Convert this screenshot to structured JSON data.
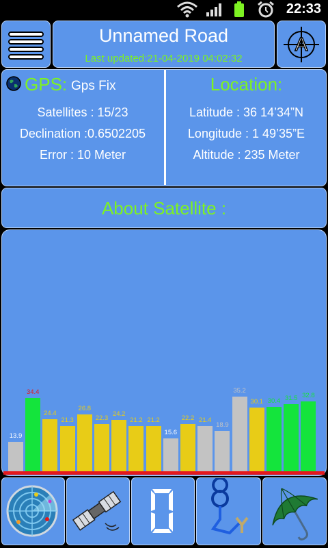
{
  "status_bar": {
    "time": "22:33"
  },
  "header": {
    "title": "Unnamed Road",
    "last_updated": "Last updated:21-04-2019 04:02:32"
  },
  "gps": {
    "title": "GPS:",
    "status": "Gps Fix",
    "satellites": "Satellites : 15/23",
    "declination": "Declination :0.6502205",
    "error": "Error : 10 Meter"
  },
  "location": {
    "title": "Location:",
    "latitude": "Latitude : 36  14’34”N",
    "longitude": "Longitude : 1  49’35”E",
    "altitude": "Altitude : 235 Meter"
  },
  "about": {
    "title": "About Satellite :"
  },
  "chart_data": {
    "type": "bar",
    "values": [
      13.9,
      34.4,
      24.4,
      21.3,
      26.8,
      22.3,
      24.2,
      21.2,
      21.2,
      15.6,
      22.2,
      21.4,
      18.9,
      35.2,
      30.1,
      30.4,
      31.5,
      32.8
    ],
    "labels": [
      "13.9",
      "34.4",
      "24.4",
      "21.3",
      "26.8",
      "22.3",
      "24.2",
      "21.2",
      "21.2",
      "15.6",
      "22.2",
      "21.4",
      "18.9",
      "35.2",
      "30.1",
      "30.4",
      "31.5",
      "32.8"
    ],
    "bar_colors": [
      "#c3c3c3",
      "#14e43c",
      "#e8cc17",
      "#e8cc17",
      "#e8cc17",
      "#e8cc17",
      "#e8cc17",
      "#e8cc17",
      "#e8cc17",
      "#c3c3c3",
      "#e8cc17",
      "#c3c3c3",
      "#c3c3c3",
      "#c3c3c3",
      "#e8cc17",
      "#14e43c",
      "#14e43c",
      "#14e43c"
    ],
    "label_colors": [
      "#ffffff",
      "#e4191d",
      "#e8cc17",
      "#e8cc17",
      "#e8cc17",
      "#e8cc17",
      "#e8cc17",
      "#e8cc17",
      "#e8cc17",
      "#ffffff",
      "#e8cc17",
      "#e8cc17",
      "#c3c3c3",
      "#c3c3c3",
      "#e8cc17",
      "#14e43c",
      "#14e43c",
      "#14e43c"
    ],
    "ylim": [
      0,
      40
    ]
  },
  "colors": {
    "panel": "#5b95ea",
    "accent_green": "#7df222",
    "baseline_red": "#e4191d"
  },
  "nav": [
    {
      "icon": "radar-icon"
    },
    {
      "icon": "satellite-icon"
    },
    {
      "icon": "digital-zero-icon"
    },
    {
      "icon": "route-icon"
    },
    {
      "icon": "umbrella-icon"
    }
  ]
}
